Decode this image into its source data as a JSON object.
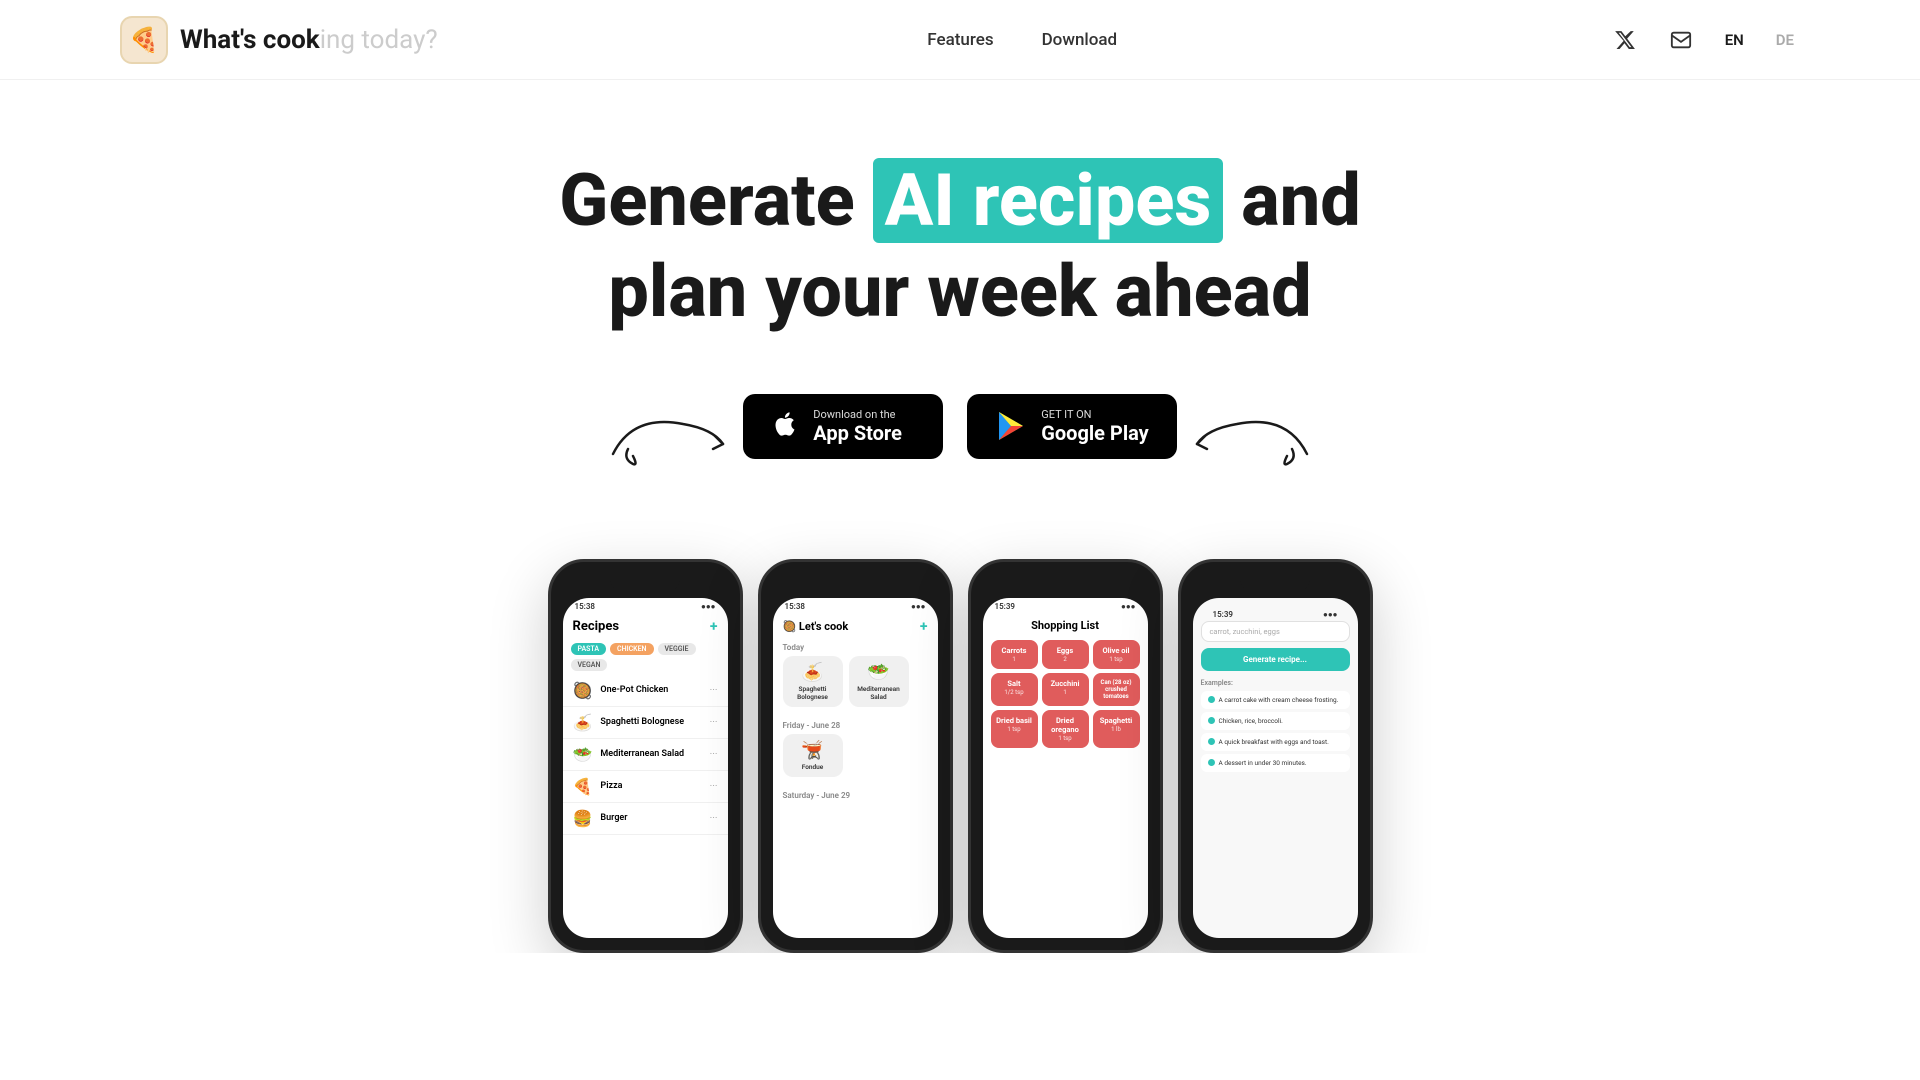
{
  "nav": {
    "logo_icon": "🍕",
    "logo_text_start": "What's cook",
    "logo_text_highlight": "ing today?",
    "links": [
      {
        "label": "Features",
        "href": "#features"
      },
      {
        "label": "Download",
        "href": "#download"
      }
    ],
    "lang_en": "EN",
    "lang_de": "DE",
    "twitter_icon": "𝕏",
    "mail_icon": "✉"
  },
  "hero": {
    "title_start": "Generate ",
    "title_highlight": "AI recipes",
    "title_end": " and",
    "title_line2": "plan your week ahead"
  },
  "store_buttons": {
    "appstore": {
      "sub": "Download on the",
      "name": "App Store",
      "icon": ""
    },
    "googleplay": {
      "sub": "GET IT ON",
      "name": "Google Play",
      "icon": "▶"
    }
  },
  "phones": {
    "phone1": {
      "time": "15:38",
      "title": "Recipes",
      "tags": [
        "PASTA",
        "CHICKEN",
        "VEGGIE",
        "VEGAN"
      ],
      "recipes": [
        {
          "emoji": "🥘",
          "name": "One-Pot Chicken"
        },
        {
          "emoji": "🍝",
          "name": "Spaghetti Bolognese"
        },
        {
          "emoji": "🥗",
          "name": "Mediterranean Salad"
        },
        {
          "emoji": "🍕",
          "name": "Pizza"
        },
        {
          "emoji": "🍔",
          "name": "Burger"
        }
      ]
    },
    "phone2": {
      "time": "15:38",
      "title": "🥘 Let's cook",
      "today": "Today",
      "friday": "Friday - June 28",
      "saturday": "Saturday - June 29",
      "meals_today": [
        {
          "emoji": "🍝",
          "name": "Spaghetti Bolognese"
        },
        {
          "emoji": "🥗",
          "name": "Mediterranean Salad"
        }
      ],
      "meals_friday": [
        {
          "emoji": "🫕",
          "name": "Fondue"
        }
      ]
    },
    "phone3": {
      "time": "15:39",
      "title": "Shopping List",
      "items": [
        {
          "name": "Carrots",
          "qty": "1"
        },
        {
          "name": "Eggs",
          "qty": "2"
        },
        {
          "name": "Olive oil",
          "qty": "1 tsp"
        },
        {
          "name": "Salt",
          "qty": "1/2 tsp"
        },
        {
          "name": "Zucchini",
          "qty": "1"
        },
        {
          "name": "Can (28 oz) crushed tomatoes",
          "qty": ""
        },
        {
          "name": "Dried basil",
          "qty": "1 tsp"
        },
        {
          "name": "Dried oregano",
          "qty": "1 tsp"
        },
        {
          "name": "Spaghetti",
          "qty": "1 lb"
        }
      ]
    },
    "phone4": {
      "time": "15:39",
      "placeholder": "carrot, zucchini, eggs",
      "generate_btn": "Generate recipe...",
      "examples_title": "Examples:",
      "examples": [
        "A carrot cake with cream cheese frosting.",
        "Chicken, rice, broccoli.",
        "A quick breakfast with eggs and toast.",
        "A dessert in under 30 minutes."
      ]
    }
  }
}
